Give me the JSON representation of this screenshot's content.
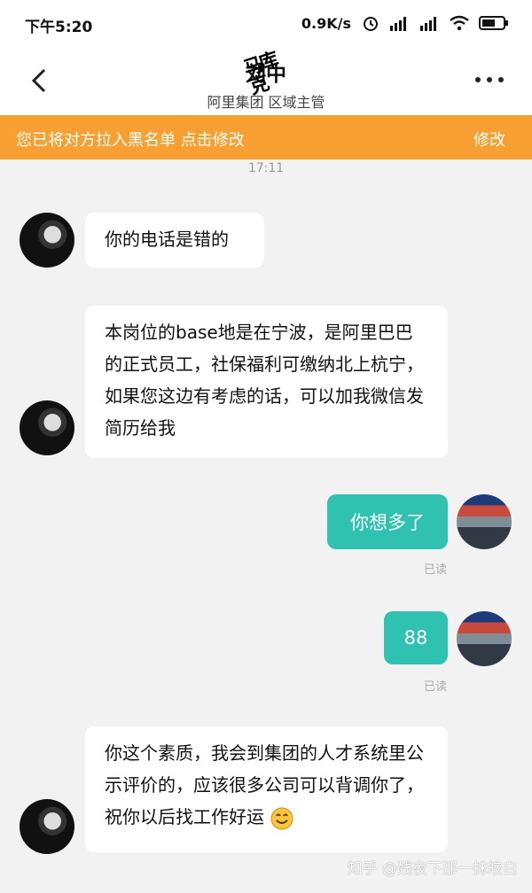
{
  "status_bar": {
    "time": "下午5:20",
    "speed": "0.9K/s",
    "icons": [
      "alarm-icon",
      "signal-hd-icon",
      "signal-hd-icon",
      "wifi-icon",
      "battery-icon"
    ]
  },
  "header": {
    "title": "刘中",
    "subtitle": "阿里集团 区域主管",
    "back_icon": "chevron-left-icon",
    "more_icon": "more-dots-icon"
  },
  "overlay_watermark": "马库克",
  "banner": {
    "text": "您已将对方拉入黑名单 点击修改",
    "action": "修改",
    "color": "#f7a031"
  },
  "chat": {
    "timestamp": "17:11",
    "messages": [
      {
        "side": "left",
        "text": "你的电话是错的"
      },
      {
        "side": "left",
        "text": "本岗位的base地是在宁波，是阿里巴巴的正式员工，社保福利可缴纳北上杭宁，如果您这边有考虑的话，可以加我微信发简历给我"
      },
      {
        "side": "right",
        "text": "你想多了",
        "status": "已读"
      },
      {
        "side": "right",
        "text": "88",
        "status": "已读"
      },
      {
        "side": "left",
        "text": "你这个素质，我会到集团的人才系统里公示评价的，应该很多公司可以背调你了，祝你以后找工作好运"
      }
    ],
    "sent_bubble_color": "#2fc2b0"
  },
  "footer_watermark": "知乎 @残夜下那一抹皎白"
}
